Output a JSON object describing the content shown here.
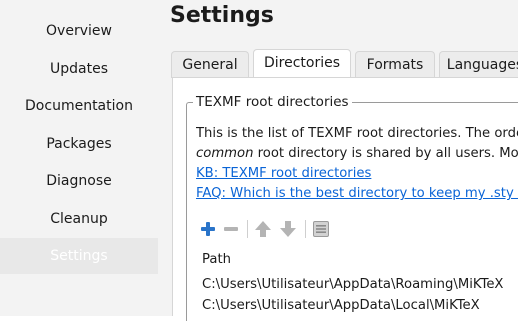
{
  "sidebar": {
    "items": [
      {
        "label": "Overview",
        "selected": false
      },
      {
        "label": "Updates",
        "selected": false
      },
      {
        "label": "Documentation",
        "selected": false
      },
      {
        "label": "Packages",
        "selected": false
      },
      {
        "label": "Diagnose",
        "selected": false
      },
      {
        "label": "Cleanup",
        "selected": false
      },
      {
        "label": "Settings",
        "selected": true
      }
    ]
  },
  "main": {
    "title": "Settings",
    "tabs": [
      {
        "label": "General",
        "active": false
      },
      {
        "label": "Directories",
        "active": true
      },
      {
        "label": "Formats",
        "active": false
      },
      {
        "label": "Languages",
        "active": false
      }
    ],
    "group": {
      "title": "TEXMF root directories",
      "desc_line1": "This is the list of TEXMF root directories. The orde",
      "desc_line2_italic": "common",
      "desc_line2_rest": " root directory is shared by all users. Mor",
      "link1": "KB: TEXMF root directories",
      "link2": "FAQ: Which is the best directory to keep my .sty fi"
    },
    "toolbar": {
      "icons": [
        "add-icon",
        "remove-icon",
        "move-up-icon",
        "move-down-icon",
        "properties-icon"
      ]
    },
    "table": {
      "header": "Path",
      "rows": [
        "C:\\Users\\Utilisateur\\AppData\\Roaming\\MiKTeX",
        "C:\\Users\\Utilisateur\\AppData\\Local\\MiKTeX"
      ]
    }
  },
  "colors": {
    "link": "#0a64d6",
    "add_icon": "#2a74c9",
    "disabled_icon": "#b4b4b4"
  }
}
